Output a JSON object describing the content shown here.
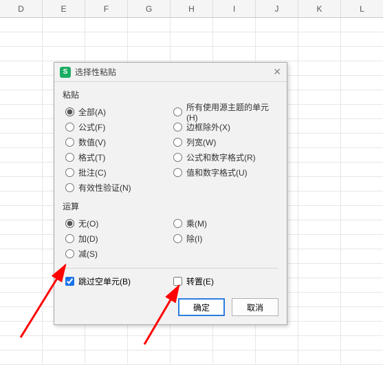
{
  "columns": [
    "D",
    "E",
    "F",
    "G",
    "H",
    "I",
    "J",
    "K",
    "L"
  ],
  "dialog": {
    "title": "选择性粘贴",
    "app_icon_letter": "S",
    "close_glyph": "✕",
    "paste_section": "粘贴",
    "paste_left": [
      {
        "label": "全部(A)",
        "checked": true
      },
      {
        "label": "公式(F)",
        "checked": false
      },
      {
        "label": "数值(V)",
        "checked": false
      },
      {
        "label": "格式(T)",
        "checked": false
      },
      {
        "label": "批注(C)",
        "checked": false
      },
      {
        "label": "有效性验证(N)",
        "checked": false
      }
    ],
    "paste_right": [
      {
        "label": "所有使用源主题的单元(H)",
        "checked": false
      },
      {
        "label": "边框除外(X)",
        "checked": false
      },
      {
        "label": "列宽(W)",
        "checked": false
      },
      {
        "label": "公式和数字格式(R)",
        "checked": false
      },
      {
        "label": "值和数字格式(U)",
        "checked": false
      }
    ],
    "op_section": "运算",
    "op_left": [
      {
        "label": "无(O)",
        "checked": true
      },
      {
        "label": "加(D)",
        "checked": false
      },
      {
        "label": "减(S)",
        "checked": false
      }
    ],
    "op_right": [
      {
        "label": "乘(M)",
        "checked": false
      },
      {
        "label": "除(I)",
        "checked": false
      }
    ],
    "skip_blanks": {
      "label": "跳过空单元(B)",
      "checked": true
    },
    "transpose": {
      "label": "转置(E)",
      "checked": false
    },
    "ok": "确定",
    "cancel": "取消"
  },
  "arrow_color": "#ff0000"
}
